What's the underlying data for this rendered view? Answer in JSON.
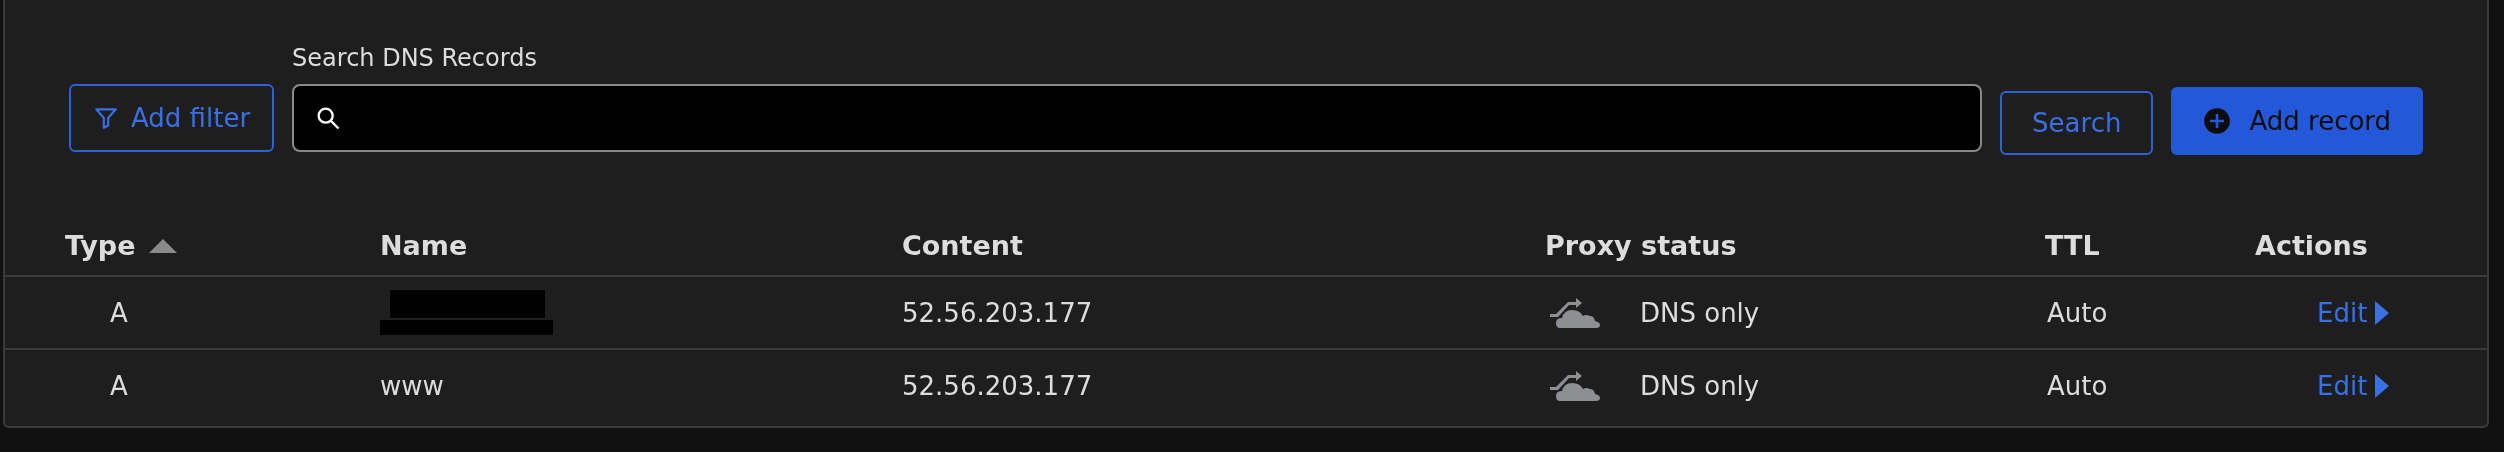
{
  "toolbar": {
    "filter_button": "Add filter",
    "search_label": "Search DNS Records",
    "search_button": "Search",
    "add_button": "Add record"
  },
  "table": {
    "columns": [
      {
        "label": "Type",
        "sorted": true
      },
      {
        "label": "Name",
        "sorted": false
      },
      {
        "label": "Content",
        "sorted": false
      },
      {
        "label": "Proxy status",
        "sorted": false
      },
      {
        "label": "TTL",
        "sorted": false
      },
      {
        "label": "Actions",
        "sorted": false
      }
    ],
    "rows": [
      {
        "type": "A",
        "name_redacted": true,
        "content": "52.56.203.177",
        "proxy_status": "DNS only",
        "ttl": "Auto",
        "action": "Edit"
      },
      {
        "type": "A",
        "name": "www",
        "name_redacted": false,
        "content": "52.56.203.177",
        "proxy_status": "DNS only",
        "ttl": "Auto",
        "action": "Edit"
      }
    ]
  }
}
